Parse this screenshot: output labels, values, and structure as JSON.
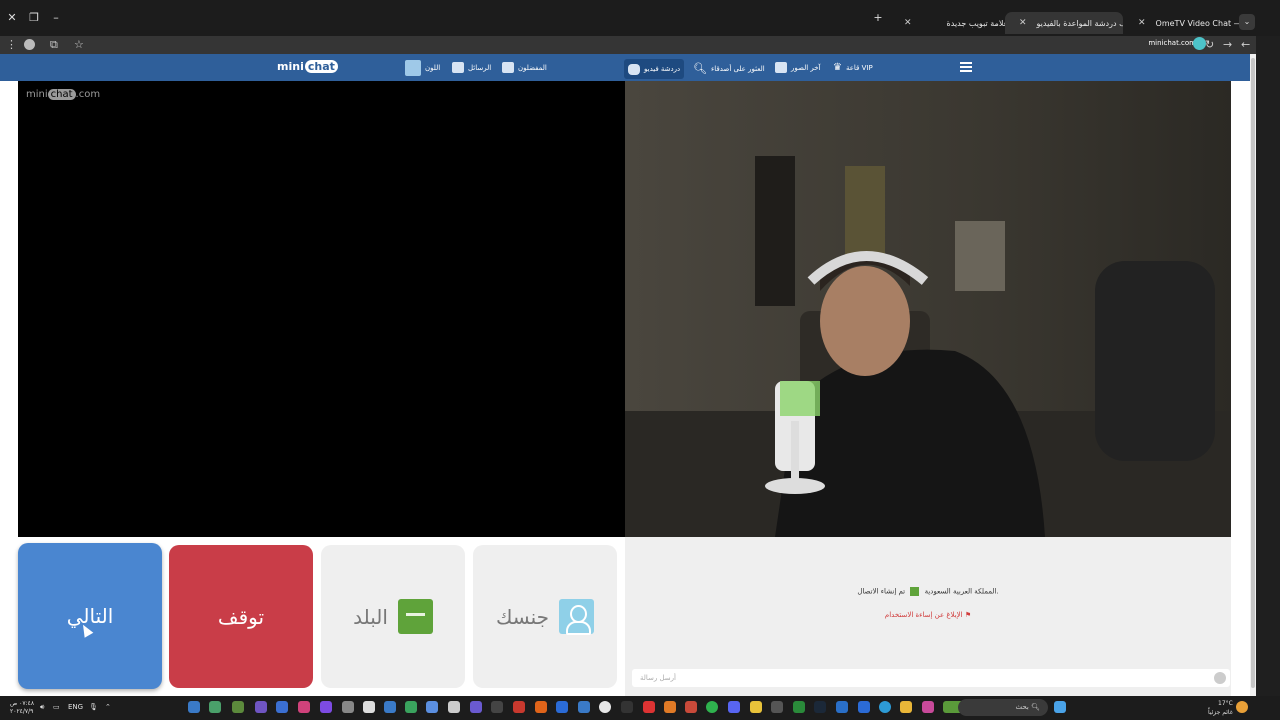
{
  "browser": {
    "tabs": [
      {
        "title": "OmeTV Video Chat — Ome",
        "icon_color": "#e64a4a",
        "active": false
      },
      {
        "title": "غرف دردشة المواعدة بالفيديو",
        "icon_color": "#e64a4a",
        "active": true
      },
      {
        "title": "علامة تبويب جديدة",
        "icon_color": "#dddddd",
        "active": false
      }
    ],
    "url": "minichat.com"
  },
  "site": {
    "logo_mini": "mini",
    "logo_chat": "chat",
    "watermark_mini": "mini",
    "watermark_chat": "chat",
    "watermark_com": ".com",
    "nav": {
      "vip": "قاعة VIP",
      "last_photos": "آخر الصور",
      "search_girls": "العثور على أصدقاء",
      "video_chat": "دردشة فيديو",
      "favorites": "المفضلون",
      "messages": "الرسائل",
      "color": "اللون"
    }
  },
  "controls": {
    "next": "التالي",
    "stop": "توقف",
    "country": "البلد",
    "gender": "جنسك"
  },
  "chat": {
    "connected": "تم إنشاء الاتصال.",
    "country": "المملكة العربية السعودية",
    "report": "الإبلاغ عن إساءة الاستخدام",
    "input_placeholder": "أرسل رسالة"
  },
  "taskbar": {
    "weather_temp": "17°C",
    "weather_desc": "غائم جزئياً",
    "search_label": "بحث",
    "lang": "ENG",
    "time": "٠٧:٤٨ ص",
    "date": "٢٠٢٤/٧/٩"
  },
  "colors": {
    "header": "#2f5f9a",
    "next": "#4a86d0",
    "stop": "#c93d48",
    "flag": "#5fa33a"
  }
}
